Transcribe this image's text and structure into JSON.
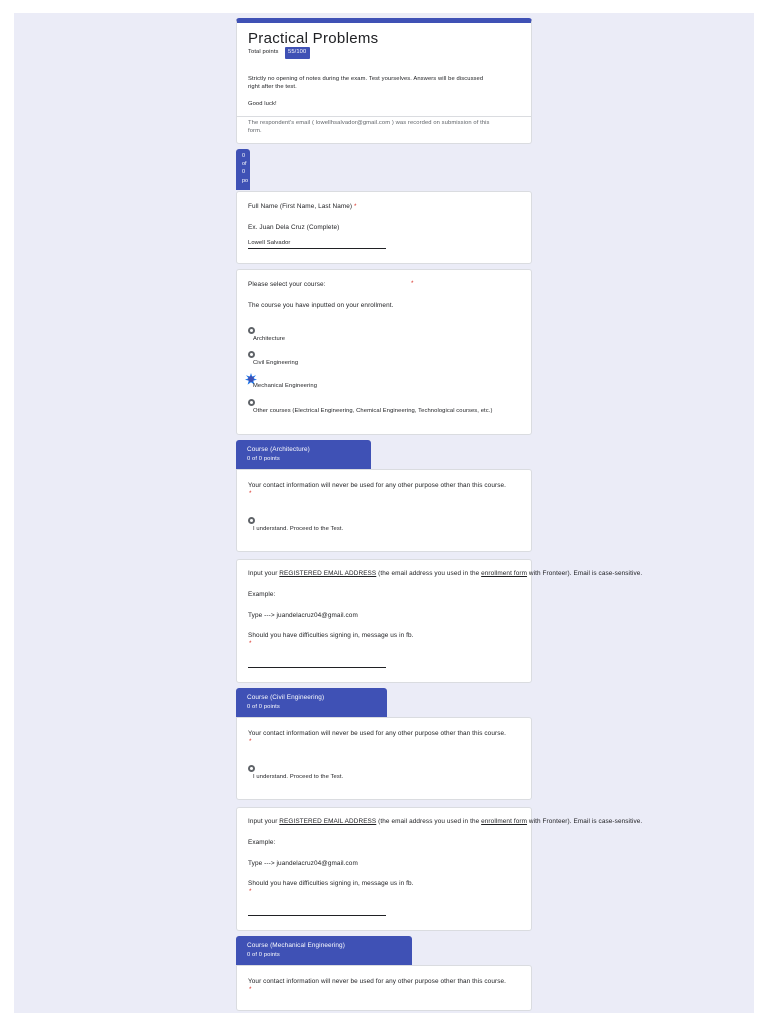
{
  "colors": {
    "accent": "#3f51b5",
    "background": "#ebecf7",
    "required": "#d93025"
  },
  "header": {
    "title": "Practical Problems",
    "points_label": "Total points",
    "points_badge": "55/100",
    "description_line1": "Strictly no opening of notes during the exam. Test yourselves. Answers will be discussed",
    "description_line2": "right after the test.",
    "good_luck": "Good luck!",
    "email_note_line1": "The respondent's email ( lowellhsalvador@gmail.com ) was recorded on submission of this",
    "email_note_line2": "form."
  },
  "mini_section": {
    "chars": [
      "0",
      "of",
      "0",
      "po"
    ]
  },
  "full_name": {
    "label": "Full Name (First Name, Last Name)",
    "required": "*",
    "hint": "Ex. Juan Dela Cruz (Complete)",
    "value": "Lowell Salvador"
  },
  "course": {
    "label": "Please select your course:",
    "required": "*",
    "hint": "The course you have inputted on your enrollment.",
    "options": [
      {
        "label": "Architecture",
        "selected": false
      },
      {
        "label": "Civil Engineering",
        "selected": false
      },
      {
        "label": "Mechanical Engineering",
        "selected": true
      },
      {
        "label": "Other courses (Electrical Engineering, Chemical Engineering, Technological courses, etc.)",
        "selected": false
      }
    ]
  },
  "sections": [
    {
      "title": "Course (Architecture)",
      "points": "0 of 0 points",
      "contact": "Your contact information will never be used for any other purpose other than this course.",
      "required": "*",
      "understand": "I understand. Proceed to the Test.",
      "email": {
        "prefix": "Input your ",
        "link1": "REGISTERED EMAIL ADDRESS",
        "middle": " (the email address you used in the ",
        "link2": "enrollment form",
        "suffix": " with Fronteer). Email is case-sensitive.",
        "example": "Example:",
        "type_line": "Type --->  juandelacruz04@gmail.com",
        "difficulty": "Should you have difficulties signing in, message us in fb.",
        "required": "*"
      }
    },
    {
      "title": "Course (Civil Engineering)",
      "points": "0 of 0 points",
      "contact": "Your contact information will never be used for any other purpose other than this course.",
      "required": "*",
      "understand": "I understand. Proceed to the Test.",
      "email": {
        "prefix": "Input your ",
        "link1": "REGISTERED EMAIL ADDRESS",
        "middle": " (the email address you used in the ",
        "link2": "enrollment form",
        "suffix": " with Fronteer).  Email is case-sensitive.",
        "example": "Example:",
        "type_line": "Type --->  juandelacruz04@gmail.com",
        "difficulty": "Should you have difficulties signing in, message us in fb.",
        "required": "*"
      }
    },
    {
      "title": "Course (Mechanical Engineering)",
      "points": "0 of 0 points",
      "contact": "Your contact information will never be used for any other purpose other than this course.",
      "required": "*"
    }
  ]
}
